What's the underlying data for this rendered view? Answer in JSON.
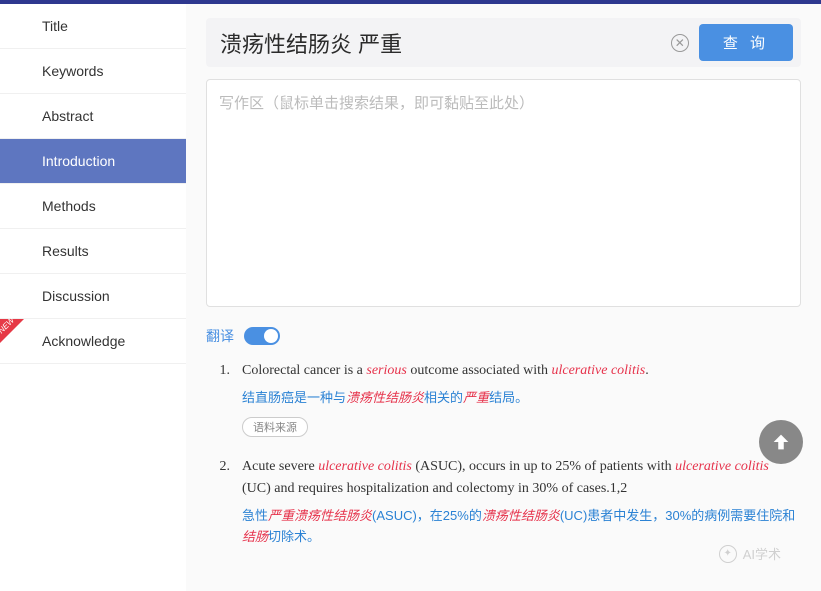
{
  "sidebar": {
    "items": [
      {
        "label": "Title"
      },
      {
        "label": "Keywords"
      },
      {
        "label": "Abstract"
      },
      {
        "label": "Introduction"
      },
      {
        "label": "Methods"
      },
      {
        "label": "Results"
      },
      {
        "label": "Discussion"
      },
      {
        "label": "Acknowledge"
      }
    ]
  },
  "search": {
    "value": "溃疡性结肠炎 严重",
    "query_label": "查 询"
  },
  "writing_area": {
    "placeholder": "写作区（鼠标单击搜索结果，即可黏贴至此处）"
  },
  "translate": {
    "label": "翻译"
  },
  "results": [
    {
      "num": "1.",
      "en_parts": [
        "Colorectal cancer is a ",
        "serious",
        " outcome associated with ",
        "ulcerative colitis",
        "."
      ],
      "cn_parts": [
        "结直肠癌是一种与",
        "溃疡性结肠炎",
        "相关的",
        "严重",
        "结局。"
      ],
      "source_label": "语料来源"
    },
    {
      "num": "2.",
      "en_parts": [
        "Acute severe ",
        "ulcerative colitis",
        " (ASUC), occurs in up to 25% of patients with ",
        "ulcerative colitis",
        " (UC) and requires hospitalization and colectomy in 30% of cases.1,2"
      ],
      "cn_parts": [
        "急性",
        "严重溃疡性结肠炎",
        "(ASUC)，在25%的",
        "溃疡性结肠炎",
        "(UC)患者中发生，30%的病例需要住院和",
        "结肠",
        "切除术。"
      ]
    }
  ],
  "watermark": {
    "text": "AI学术"
  }
}
